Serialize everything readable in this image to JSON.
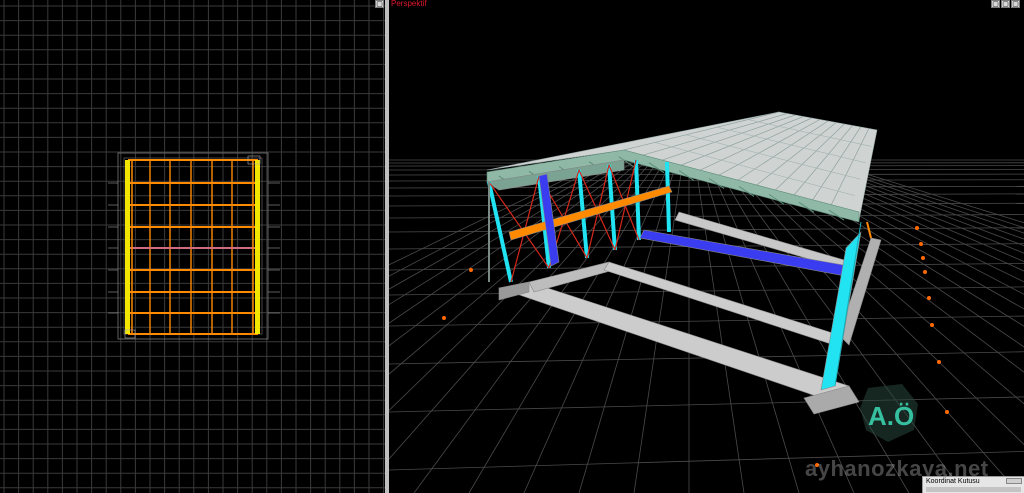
{
  "plan_view": {
    "maximize_btn": "▢"
  },
  "perspective_view": {
    "title": "Perspektif",
    "btn_min": "▢",
    "btn_restore": "▢",
    "btn_max": "▢"
  },
  "coordinate_box": {
    "title": "Koordinat Kutusu"
  },
  "watermark": {
    "logo": "A.Ö",
    "text": "ayhanozkaya.net"
  },
  "colors": {
    "grid": "#3a3a3a",
    "frame_orange": "#ff8a00",
    "frame_yellow": "#f3e600",
    "column_cyan": "#21e3f2",
    "brace_red": "#d6281a",
    "beam_blue": "#3a3cf0",
    "roof_gray": "#cfd4d2",
    "truss_green": "#8fb8a6",
    "footing_gray": "#cccccc",
    "title_red": "#e0182a"
  }
}
